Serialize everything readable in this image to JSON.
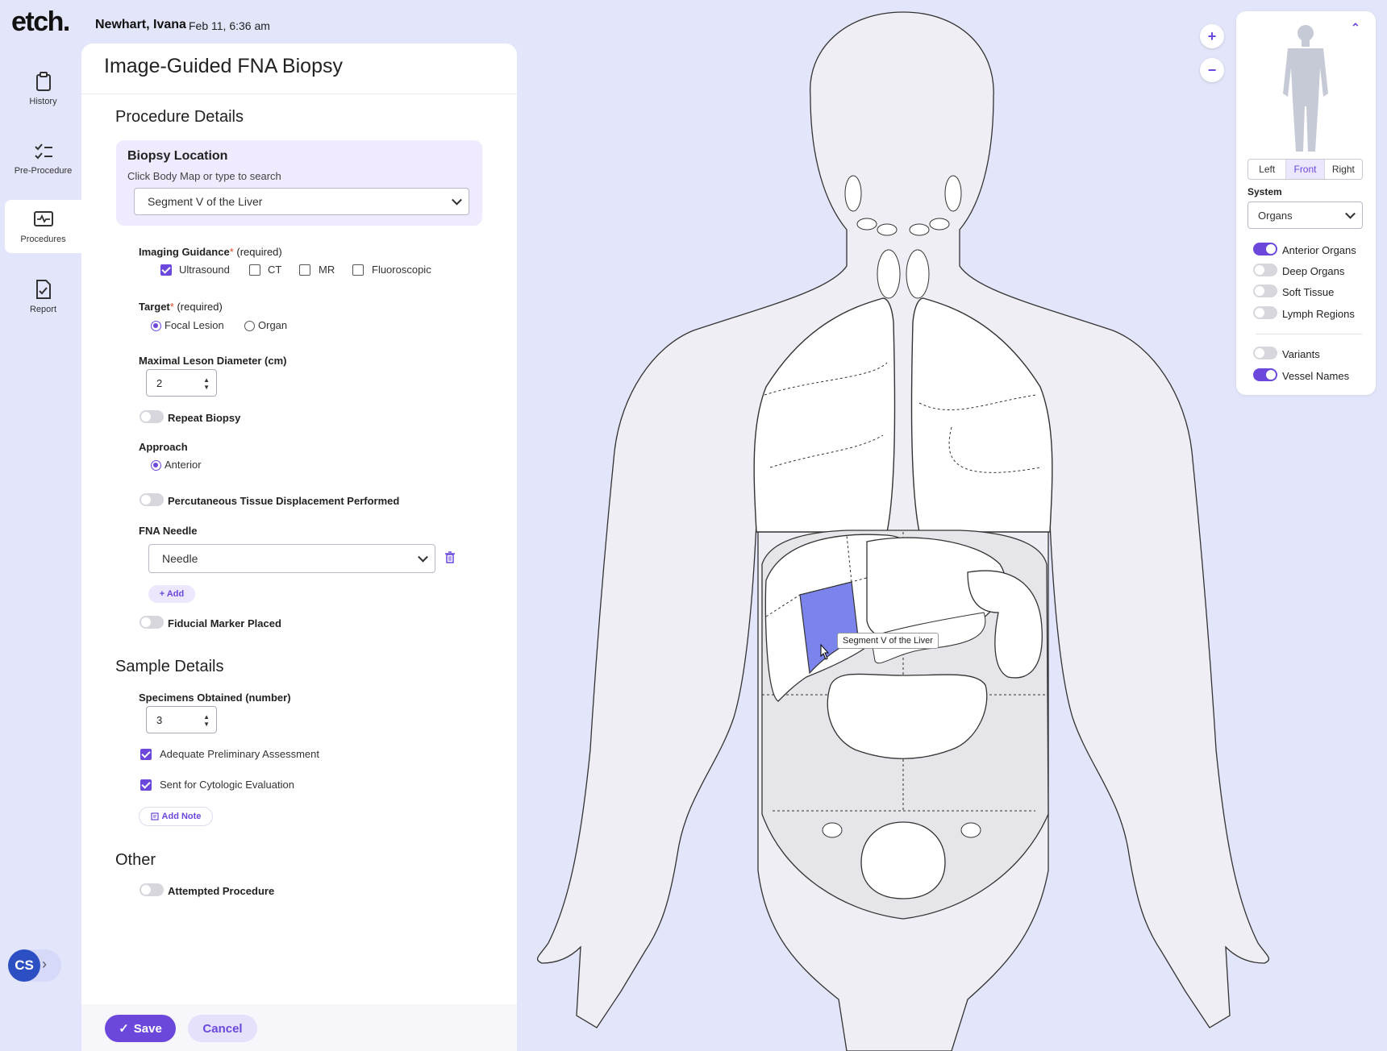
{
  "header": {
    "logo": "etch.",
    "patient_name": "Newhart, Ivana",
    "datetime": "Feb 11, 6:36 am"
  },
  "nav": {
    "history": "History",
    "pre_procedure": "Pre-Procedure",
    "procedures": "Procedures",
    "report": "Report",
    "user_initials": "CS",
    "expand_glyph": "›"
  },
  "form": {
    "title": "Image-Guided FNA Biopsy",
    "procedure_details": "Procedure Details",
    "biopsy_location": {
      "title": "Biopsy Location",
      "subtitle": "Click Body Map or type to search",
      "value": "Segment V of the Liver"
    },
    "imaging_guidance": {
      "label": "Imaging Guidance",
      "star": "*",
      "required": "(required)",
      "options": [
        {
          "label": "Ultrasound",
          "checked": true
        },
        {
          "label": "CT",
          "checked": false
        },
        {
          "label": "MR",
          "checked": false
        },
        {
          "label": "Fluoroscopic",
          "checked": false
        }
      ]
    },
    "target": {
      "label": "Target",
      "star": "*",
      "required": "(required)",
      "options": [
        {
          "label": "Focal Lesion",
          "selected": true
        },
        {
          "label": "Organ",
          "selected": false
        }
      ]
    },
    "max_diameter": {
      "label": "Maximal Leson Diameter (cm)",
      "value": "2"
    },
    "repeat_biopsy": {
      "label": "Repeat Biopsy",
      "on": false
    },
    "approach": {
      "label": "Approach",
      "option": "Anterior",
      "selected": true
    },
    "displacement": {
      "label": "Percutaneous Tissue Displacement Performed",
      "on": false
    },
    "fna_needle": {
      "label": "FNA Needle",
      "value": "Needle",
      "add": "+ Add"
    },
    "fiducial": {
      "label": "Fiducial Marker Placed",
      "on": false
    },
    "sample_details": "Sample Details",
    "specimens": {
      "label": "Specimens Obtained (number)",
      "value": "3"
    },
    "adequate": {
      "label": "Adequate Preliminary Assessment",
      "checked": true
    },
    "cytologic": {
      "label": "Sent for Cytologic Evaluation",
      "checked": true
    },
    "add_note": "Add Note",
    "other": "Other",
    "attempted": {
      "label": "Attempted Procedure",
      "on": false
    },
    "save": "Save",
    "cancel": "Cancel"
  },
  "body_map": {
    "zoom_in": "+",
    "zoom_out": "−",
    "tooltip": "Segment V of the Liver",
    "highlight_color": "#7b84ec"
  },
  "map_controls": {
    "collapse_glyph": "⌃",
    "views": [
      "Left",
      "Front",
      "Right"
    ],
    "selected_view": "Front",
    "system_label": "System",
    "system_value": "Organs",
    "layers": [
      {
        "label": "Anterior Organs",
        "on": true
      },
      {
        "label": "Deep Organs",
        "on": false
      },
      {
        "label": "Soft Tissue",
        "on": false
      },
      {
        "label": "Lymph Regions",
        "on": false
      }
    ],
    "extras": [
      {
        "label": "Variants",
        "on": false
      },
      {
        "label": "Vessel Names",
        "on": true
      }
    ]
  },
  "colors": {
    "accent": "#6b47dc",
    "background": "#e3e5fa"
  }
}
